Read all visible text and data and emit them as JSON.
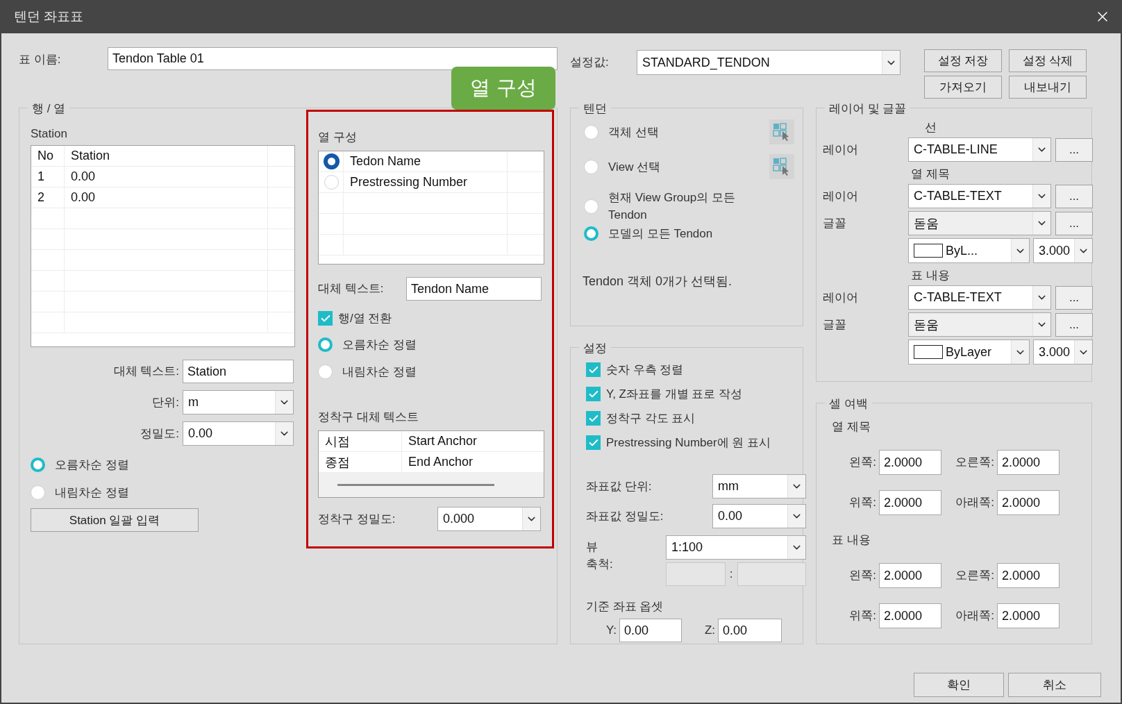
{
  "window": {
    "title": "텐던 좌표표"
  },
  "table_name": {
    "label": "표 이름:",
    "value": "Tendon Table 01"
  },
  "preset": {
    "label": "설정값:",
    "value": "STANDARD_TENDON"
  },
  "preset_buttons": [
    "설정 저장",
    "설정 삭제",
    "가져오기",
    "내보내기"
  ],
  "callout": "열 구성",
  "rows_columns": {
    "legend": "행 / 열",
    "station": {
      "title": "Station",
      "columns": [
        "No",
        "Station"
      ],
      "rows": [
        [
          "1",
          "0.00"
        ],
        [
          "2",
          "0.00"
        ]
      ],
      "alt_text": {
        "label": "대체 텍스트:",
        "value": "Station"
      },
      "unit": {
        "label": "단위:",
        "value": "m"
      },
      "precision": {
        "label": "정밀도:",
        "value": "0.00"
      },
      "sort": [
        {
          "label": "오름차순 정렬",
          "selected": true
        },
        {
          "label": "내림차순 정렬",
          "selected": false
        }
      ],
      "bulk_button": "Station 일괄 입력"
    },
    "column_config": {
      "title": "열 구성",
      "items": [
        {
          "label": "Tedon Name",
          "selected": true
        },
        {
          "label": "Prestressing Number",
          "selected": false
        }
      ],
      "alt_text": {
        "label": "대체 텍스트:",
        "value": "Tendon Name"
      },
      "transpose": {
        "label": "행/열 전환",
        "checked": true
      },
      "sort": [
        {
          "label": "오름차순 정렬",
          "selected": true
        },
        {
          "label": "내림차순 정렬",
          "selected": false
        }
      ],
      "anchor_title": "정착구 대체 텍스트",
      "anchor_rows": [
        [
          "시점",
          "Start Anchor"
        ],
        [
          "종점",
          "End Anchor"
        ]
      ],
      "anchor_precision": {
        "label": "정착구 정밀도:",
        "value": "0.000"
      }
    }
  },
  "tendon": {
    "legend": "텐던",
    "options": [
      {
        "label": "객체 선택",
        "selected": false,
        "pick": true
      },
      {
        "label": "View 선택",
        "selected": false,
        "pick": true
      },
      {
        "label": "현재 View Group의 모든 Tendon",
        "selected": false,
        "pick": false
      },
      {
        "label": "모델의 모든 Tendon",
        "selected": true,
        "pick": false
      }
    ],
    "status": "Tendon 객체 0개가 선택됨."
  },
  "settings": {
    "legend": "설정",
    "checks": [
      {
        "label": "숫자 우측 정렬",
        "checked": true
      },
      {
        "label": "Y, Z좌표를 개별 표로 작성",
        "checked": true
      },
      {
        "label": "정착구 각도 표시",
        "checked": true
      },
      {
        "label": "Prestressing Number에 원 표시",
        "checked": true
      }
    ],
    "fields": [
      {
        "label": "좌표값 단위:",
        "value": "mm"
      },
      {
        "label": "좌표값 정밀도:",
        "value": "0.00"
      }
    ],
    "scale": {
      "label": "뷰 축척:",
      "value": "1:100",
      "separator": ":"
    },
    "offset": {
      "title": "기준 좌표 옵셋",
      "y": {
        "label": "Y:",
        "value": "0.00"
      },
      "z": {
        "label": "Z:",
        "value": "0.00"
      }
    }
  },
  "layer_font": {
    "legend": "레이어 및 글꼴",
    "sections": [
      {
        "title": "선",
        "rows": [
          {
            "kind": "layer",
            "label": "레이어",
            "value": "C-TABLE-LINE",
            "button": "..."
          }
        ]
      },
      {
        "title": "열 제목",
        "rows": [
          {
            "kind": "layer",
            "label": "레이어",
            "value": "C-TABLE-TEXT",
            "button": "..."
          },
          {
            "kind": "font",
            "label": "글꼴",
            "value": "돋움",
            "button": "..."
          },
          {
            "kind": "style",
            "line_style": "ByL...",
            "size": "3.000"
          }
        ]
      },
      {
        "title": "표 내용",
        "rows": [
          {
            "kind": "layer",
            "label": "레이어",
            "value": "C-TABLE-TEXT",
            "button": "..."
          },
          {
            "kind": "font",
            "label": "글꼴",
            "value": "돋움",
            "button": "..."
          },
          {
            "kind": "style",
            "line_style": "ByLayer",
            "size": "3.000"
          }
        ]
      }
    ]
  },
  "cell_margin": {
    "legend": "셀 여백",
    "sections": [
      {
        "title": "열 제목",
        "fields": [
          {
            "label": "왼쪽:",
            "value": "2.0000"
          },
          {
            "label": "오른쪽:",
            "value": "2.0000"
          },
          {
            "label": "위쪽:",
            "value": "2.0000"
          },
          {
            "label": "아래쪽:",
            "value": "2.0000"
          }
        ]
      },
      {
        "title": "표 내용",
        "fields": [
          {
            "label": "왼쪽:",
            "value": "2.0000"
          },
          {
            "label": "오른쪽:",
            "value": "2.0000"
          },
          {
            "label": "위쪽:",
            "value": "2.0000"
          },
          {
            "label": "아래쪽:",
            "value": "2.0000"
          }
        ]
      }
    ]
  },
  "footer": [
    "확인",
    "취소"
  ]
}
